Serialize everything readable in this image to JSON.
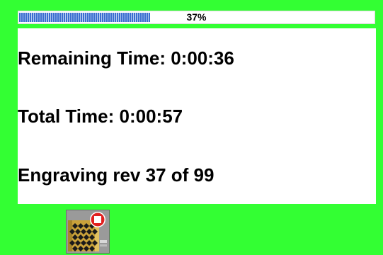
{
  "progress": {
    "percent_label": "37%",
    "fraction": 0.37
  },
  "status": {
    "remaining_time": "Remaining Time: 0:00:36",
    "total_time": "Total Time: 0:00:57",
    "engraving_rev": "Engraving rev 37 of 99"
  },
  "stop_button": {
    "icon": "stop-engraving-icon"
  },
  "colors": {
    "background": "#33ff33",
    "progress_fill": "#3b6fd0",
    "stop_badge": "#e02020"
  }
}
